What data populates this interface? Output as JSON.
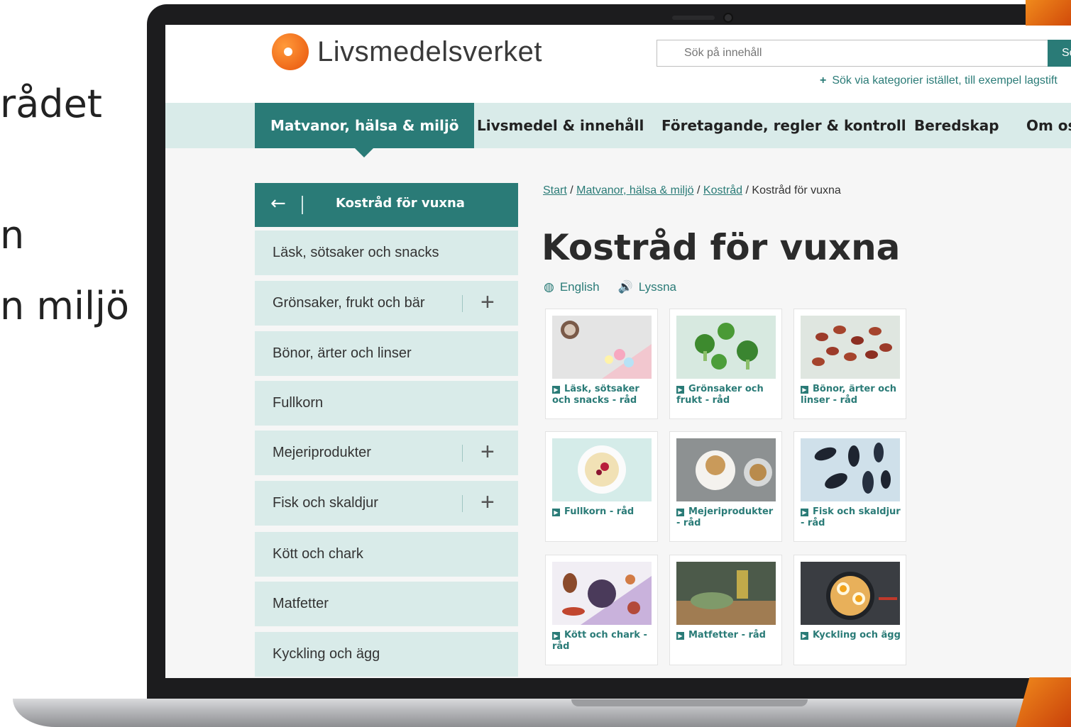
{
  "slide": {
    "fragments": [
      "rådet",
      "n",
      "n miljö"
    ]
  },
  "header": {
    "logo_text": "Livsmedelsverket",
    "search_placeholder": "Sök på innehåll",
    "search_button": "Sö",
    "category_search": "Sök via kategorier istället, till exempel lagstift"
  },
  "nav": {
    "items": [
      {
        "label": "Matvanor, hälsa & miljö",
        "active": true
      },
      {
        "label": "Livsmedel & innehåll"
      },
      {
        "label": "Företagande, regler & kontroll"
      },
      {
        "label": "Beredskap"
      },
      {
        "label": "Om os"
      }
    ]
  },
  "sidebar": {
    "header": "Kostråd för vuxna",
    "items": [
      {
        "label": "Läsk, sötsaker och snacks",
        "expandable": false
      },
      {
        "label": "Grönsaker, frukt och bär",
        "expandable": true
      },
      {
        "label": "Bönor, ärter och linser",
        "expandable": false
      },
      {
        "label": "Fullkorn",
        "expandable": false
      },
      {
        "label": "Mejeriprodukter",
        "expandable": true
      },
      {
        "label": "Fisk och skaldjur",
        "expandable": true
      },
      {
        "label": "Kött och chark",
        "expandable": false
      },
      {
        "label": "Matfetter",
        "expandable": false
      },
      {
        "label": "Kyckling och ägg",
        "expandable": false
      }
    ]
  },
  "breadcrumb": {
    "items": [
      "Start",
      "Matvanor, hälsa & miljö",
      "Kostråd"
    ],
    "current": "Kostråd för vuxna",
    "separator": "/"
  },
  "main": {
    "title": "Kostråd för vuxna",
    "english": "English",
    "listen": "Lyssna"
  },
  "cards": [
    {
      "caption": "Läsk, sötsaker och snacks - råd",
      "image": "candy"
    },
    {
      "caption": "Grönsaker och frukt - råd",
      "image": "broccoli"
    },
    {
      "caption": "Bönor, ärter och linser - råd",
      "image": "beans"
    },
    {
      "caption": "Fullkorn - råd",
      "image": "grains"
    },
    {
      "caption": "Mejeriprodukter - råd",
      "image": "yogurt"
    },
    {
      "caption": "Fisk och skaldjur - råd",
      "image": "mussels"
    },
    {
      "caption": "Kött och chark - råd",
      "image": "meat"
    },
    {
      "caption": "Matfetter - råd",
      "image": "oil"
    },
    {
      "caption": "Kyckling och ägg",
      "image": "ramen"
    }
  ],
  "colors": {
    "brand_teal": "#2a7b77",
    "nav_bg": "#d9ebe9",
    "logo_orange": "#e8530c"
  }
}
